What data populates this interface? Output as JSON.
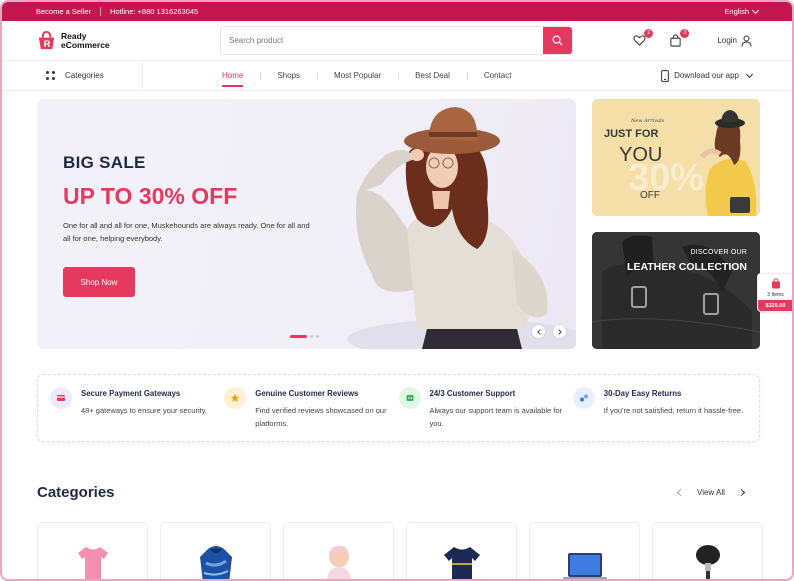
{
  "topbar": {
    "seller": "Become a Seller",
    "hotline": "Hotline: +880 1316263045",
    "language": "English"
  },
  "header": {
    "logo_line1": "Ready",
    "logo_line2": "eCommerce",
    "search_placeholder": "Search product",
    "wishlist_count": "2",
    "cart_count": "3",
    "login_label": "Login"
  },
  "nav": {
    "categories_label": "Categories",
    "items": [
      {
        "label": "Home",
        "active": true
      },
      {
        "label": "Shops"
      },
      {
        "label": "Most Popular"
      },
      {
        "label": "Best Deal"
      },
      {
        "label": "Contact"
      }
    ],
    "download_label": "Download our app"
  },
  "hero": {
    "headline": "BIG SALE",
    "offer": "UP TO 30% OFF",
    "description": "One for all and all for one, Muskehounds are always ready. One for all and all for one, helping everybody.",
    "button": "Shop Now"
  },
  "promos": {
    "first": {
      "tag": "New Arrivals",
      "line1": "JUST FOR",
      "line2": "YOU",
      "percent": "30%",
      "line3": "OFF"
    },
    "second": {
      "line1": "DISCOVER OUR",
      "line2": "LEATHER COLLECTION"
    }
  },
  "floating_cart": {
    "items": "3 Items",
    "amount": "$325.00"
  },
  "features": [
    {
      "title": "Secure Payment Gateways",
      "desc": "48+ gateways to ensure your security.",
      "icon": "credit-card-icon",
      "bg": "#ece9fb",
      "fg": "#e5395f"
    },
    {
      "title": "Genuine Customer Reviews",
      "desc": "Find verified reviews showcased on our platforms.",
      "icon": "star-icon",
      "bg": "#fdf1cf",
      "fg": "#e8a317"
    },
    {
      "title": "24/3 Customer Support",
      "desc": "Always our support team is available for you.",
      "icon": "support-icon",
      "bg": "#e0f7e3",
      "fg": "#2fb45a"
    },
    {
      "title": "30-Day Easy Returns",
      "desc": "If you're not satisfied, return it hassle-free.",
      "icon": "return-icon",
      "bg": "#e6eeff",
      "fg": "#3f74e8"
    }
  ],
  "categories": {
    "title": "Categories",
    "view_all": "View All",
    "cards": [
      {
        "icon": "pink-tshirt-icon"
      },
      {
        "icon": "tie-dye-hoodie-icon"
      },
      {
        "icon": "baby-icon"
      },
      {
        "icon": "football-jersey-icon"
      },
      {
        "icon": "laptop-icon"
      },
      {
        "icon": "makeup-brush-icon"
      }
    ]
  },
  "colors": {
    "brand": "#e5395f",
    "topbar": "#c2184f",
    "navy": "#1e2a45"
  }
}
